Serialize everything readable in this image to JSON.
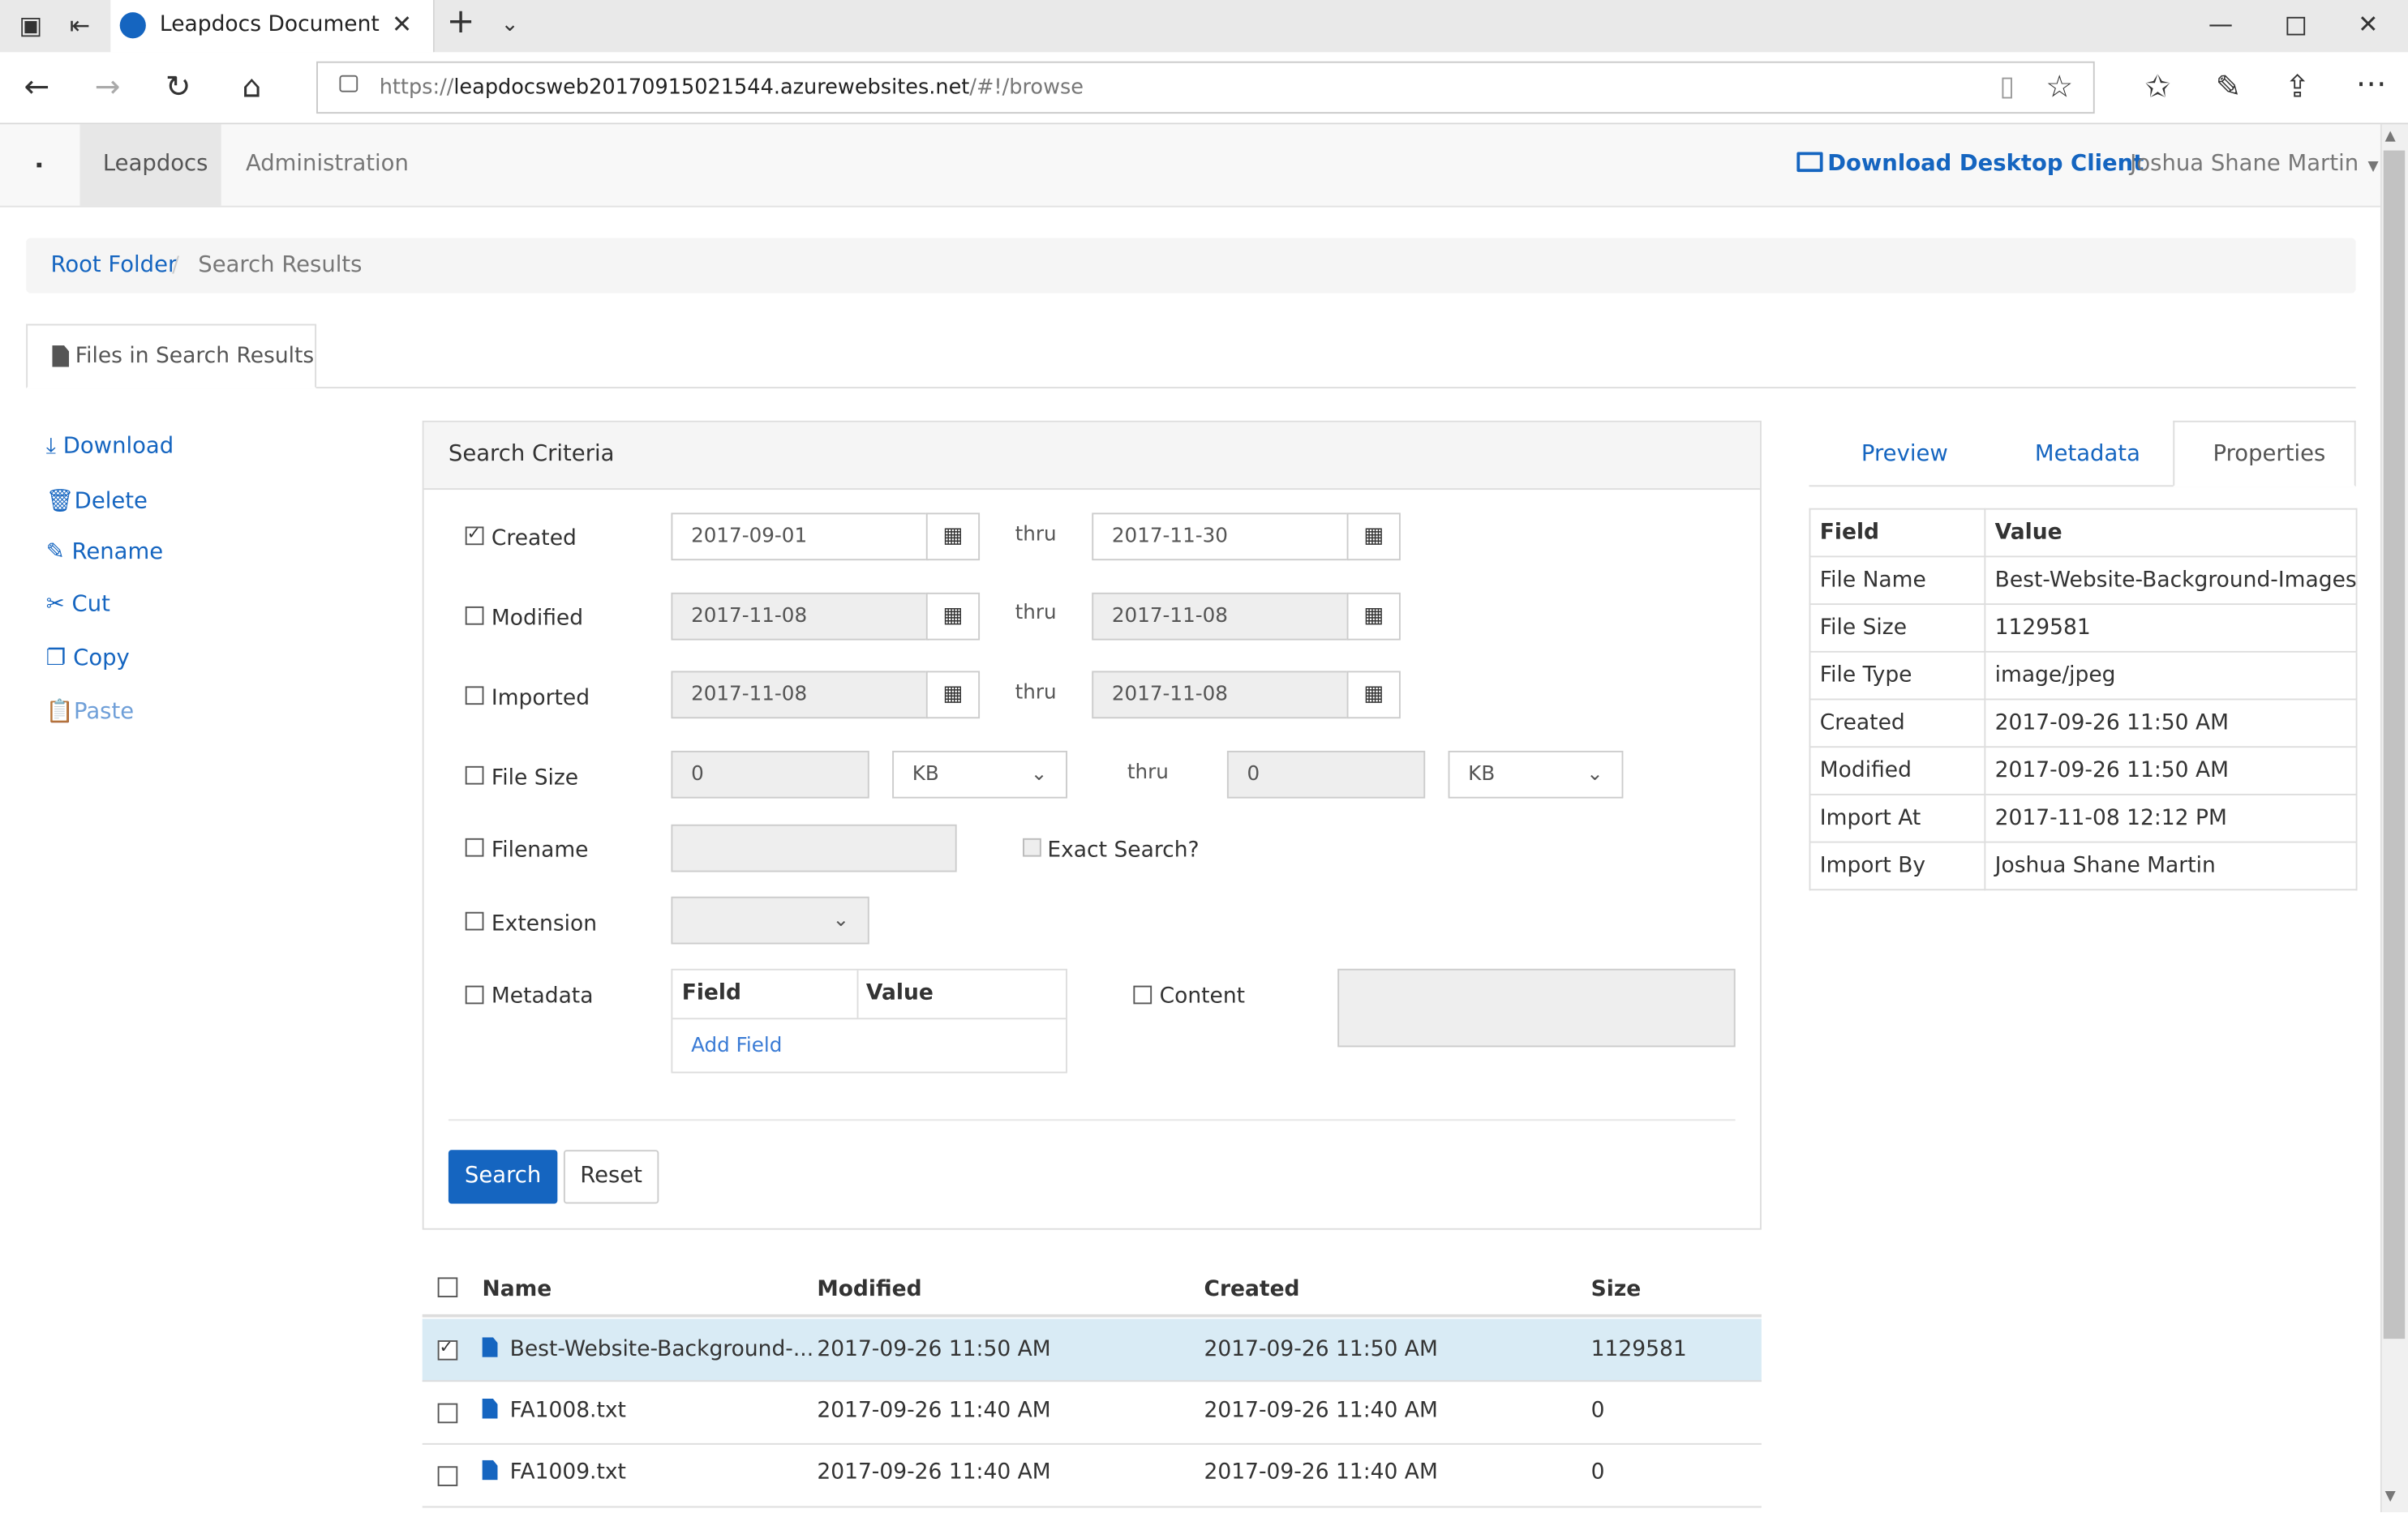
{
  "browser": {
    "tab_title": "Leapdocs Document Ma",
    "url_prefix": "https://",
    "url_host": "leapdocsweb20170915021544.azurewebsites.net",
    "url_path": "/#!/browse"
  },
  "navbar": {
    "brand": "Leapdocs",
    "admin": "Administration",
    "download_client": "Download Desktop Client",
    "user": "Joshua Shane Martin"
  },
  "breadcrumb": {
    "root": "Root Folder",
    "current": "Search Results"
  },
  "tab_label": "Files in Search Results",
  "actions": [
    "Download",
    "Delete",
    "Rename",
    "Cut",
    "Copy",
    "Paste"
  ],
  "criteria": {
    "title": "Search Criteria",
    "thru": "thru",
    "created": {
      "label": "Created",
      "from": "2017-09-01",
      "to": "2017-11-30"
    },
    "modified": {
      "label": "Modified",
      "from": "2017-11-08",
      "to": "2017-11-08"
    },
    "imported": {
      "label": "Imported",
      "from": "2017-11-08",
      "to": "2017-11-08"
    },
    "filesize": {
      "label": "File Size",
      "from": "0",
      "from_unit": "KB",
      "to": "0",
      "to_unit": "KB"
    },
    "filename": {
      "label": "Filename",
      "exact": "Exact Search?"
    },
    "extension": {
      "label": "Extension"
    },
    "metadata": {
      "label": "Metadata",
      "col_field": "Field",
      "col_value": "Value",
      "add_field": "Add Field"
    },
    "content": {
      "label": "Content"
    },
    "search_btn": "Search",
    "reset_btn": "Reset"
  },
  "results": {
    "headers": {
      "name": "Name",
      "modified": "Modified",
      "created": "Created",
      "size": "Size"
    },
    "rows": [
      {
        "name": "Best-Website-Background-...",
        "modified": "2017-09-26 11:50 AM",
        "created": "2017-09-26 11:50 AM",
        "size": "1129581"
      },
      {
        "name": "FA1008.txt",
        "modified": "2017-09-26 11:40 AM",
        "created": "2017-09-26 11:40 AM",
        "size": "0"
      },
      {
        "name": "FA1009.txt",
        "modified": "2017-09-26 11:40 AM",
        "created": "2017-09-26 11:40 AM",
        "size": "0"
      }
    ]
  },
  "sidepanel": {
    "tabs": [
      "Preview",
      "Metadata",
      "Properties"
    ],
    "col_field": "Field",
    "col_value": "Value",
    "props": [
      {
        "field": "File Name",
        "value": "Best-Website-Background-Images..."
      },
      {
        "field": "File Size",
        "value": "1129581"
      },
      {
        "field": "File Type",
        "value": "image/jpeg"
      },
      {
        "field": "Created",
        "value": "2017-09-26 11:50 AM"
      },
      {
        "field": "Modified",
        "value": "2017-09-26 11:50 AM"
      },
      {
        "field": "Import At",
        "value": "2017-11-08 12:12 PM"
      },
      {
        "field": "Import By",
        "value": "Joshua Shane Martin"
      }
    ]
  }
}
